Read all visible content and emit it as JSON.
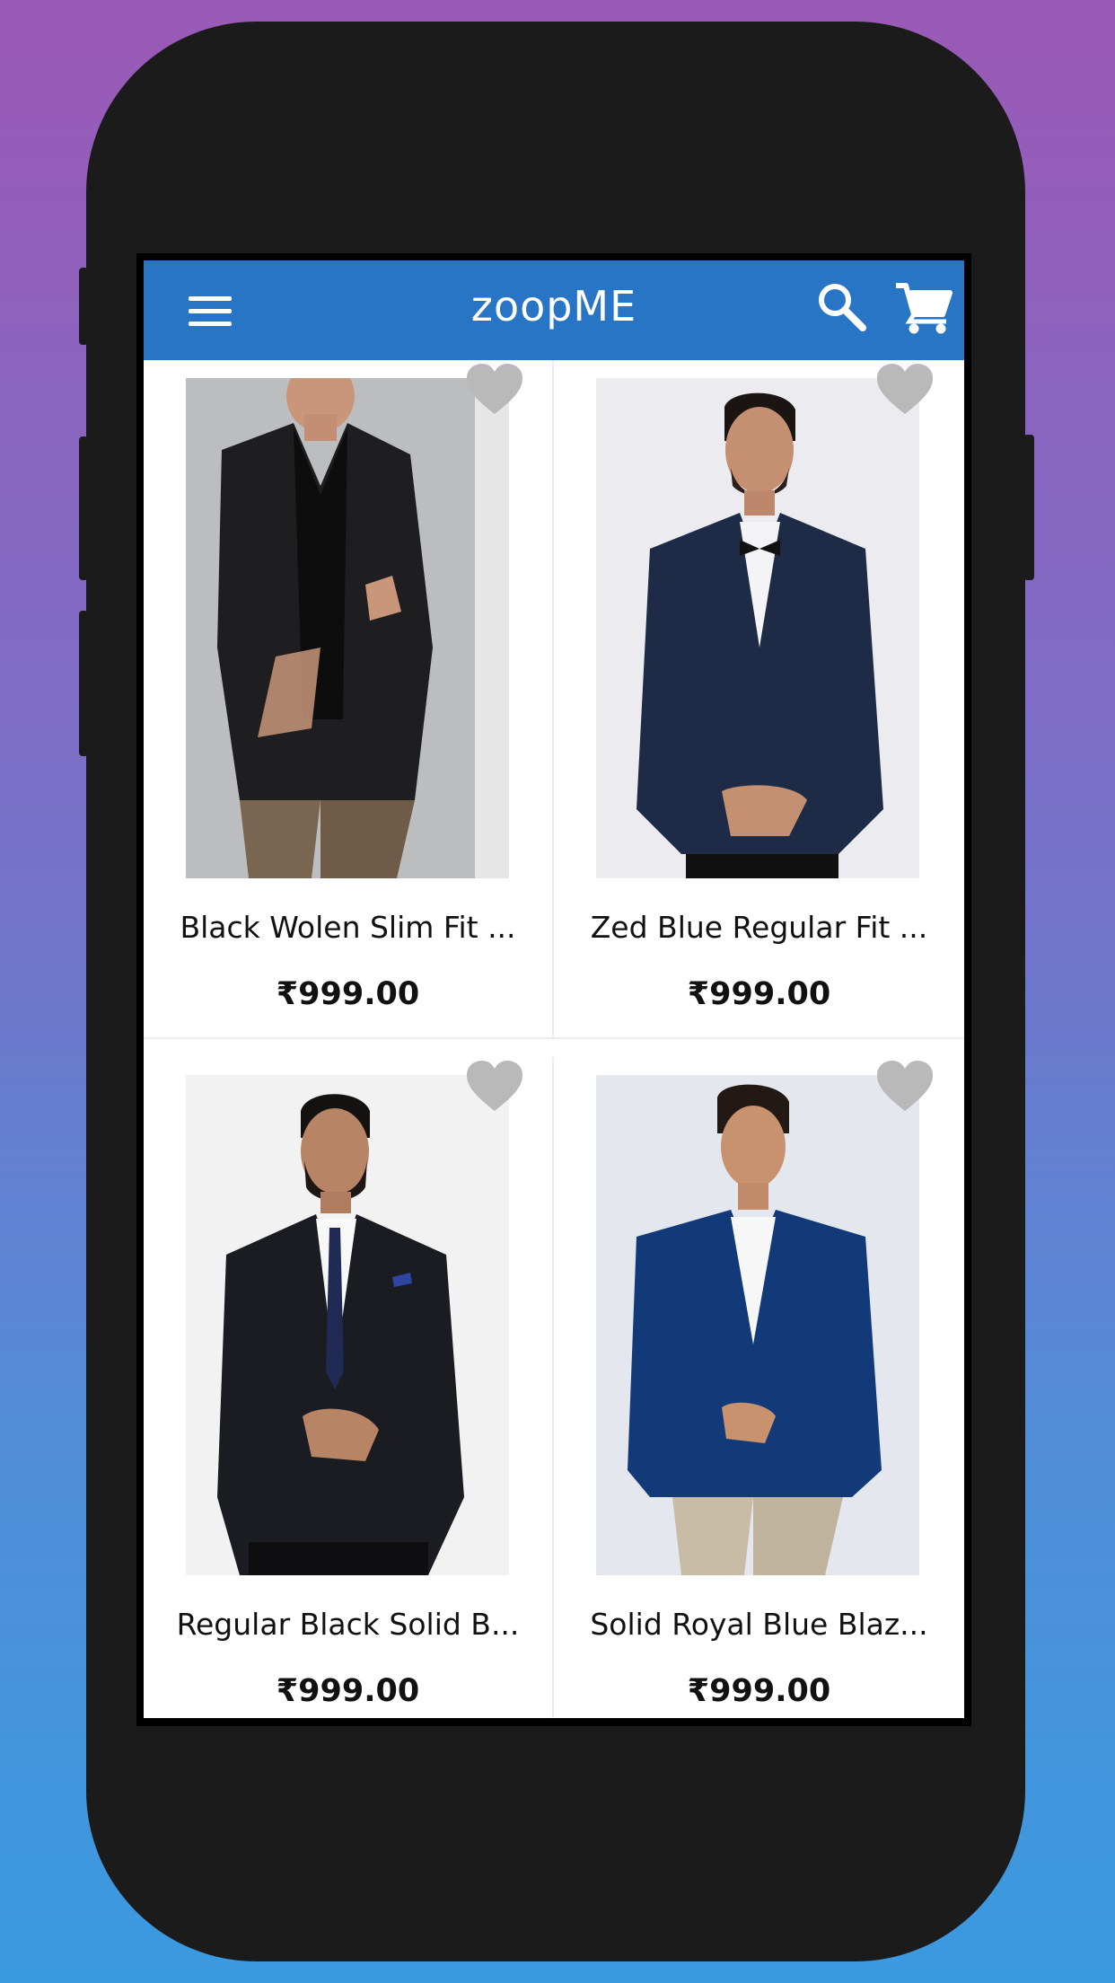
{
  "app": {
    "title": "zoopME",
    "accent_color": "#2775c4"
  },
  "toolbar": {
    "menu_icon": "hamburger-menu-icon",
    "search_icon": "search-icon",
    "cart_icon": "shopping-cart-icon"
  },
  "products": [
    {
      "name": "Black Wolen Slim Fit ...",
      "price": "₹999.00",
      "favorite": false
    },
    {
      "name": "Zed Blue Regular Fit ...",
      "price": "₹999.00",
      "favorite": false
    },
    {
      "name": "Regular Black Solid B...",
      "price": "₹999.00",
      "favorite": false
    },
    {
      "name": "Solid Royal Blue Blaz...",
      "price": "₹999.00",
      "favorite": false
    }
  ]
}
